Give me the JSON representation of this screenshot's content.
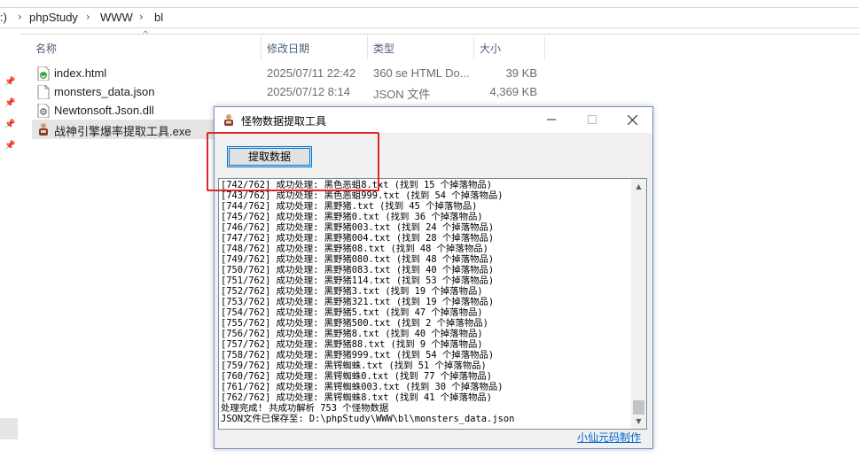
{
  "breadcrumb": {
    "prefix": ":)",
    "items": [
      "phpStudy",
      "WWW",
      "bl"
    ]
  },
  "columns": {
    "name": "名称",
    "date": "修改日期",
    "type": "类型",
    "size": "大小"
  },
  "files": [
    {
      "name": "index.html",
      "date": "2025/07/11 22:42",
      "type": "360 se HTML Do...",
      "size": "39 KB",
      "icon": "html-file-icon"
    },
    {
      "name": "monsters_data.json",
      "date": "2025/07/12 8:14",
      "type": "JSON 文件",
      "size": "4,369 KB",
      "icon": "json-file-icon"
    },
    {
      "name": "Newtonsoft.Json.dll",
      "date": "",
      "type": "",
      "size": "",
      "icon": "dll-file-icon"
    },
    {
      "name": "战神引擎爆率提取工具.exe",
      "date": "",
      "type": "",
      "size": "",
      "icon": "exe-file-icon"
    }
  ],
  "app": {
    "title": "怪物数据提取工具",
    "extract_button": "提取数据",
    "credit": "小仙元码制作",
    "log_lines": [
      "[742/762] 成功处理: 黑色恶蛆8.txt (找到 15 个掉落物品)",
      "[743/762] 成功处理: 黑色恶蛆999.txt (找到 54 个掉落物品)",
      "[744/762] 成功处理: 黑野猪.txt (找到 45 个掉落物品)",
      "[745/762] 成功处理: 黑野猪0.txt (找到 36 个掉落物品)",
      "[746/762] 成功处理: 黑野猪003.txt (找到 24 个掉落物品)",
      "[747/762] 成功处理: 黑野猪004.txt (找到 28 个掉落物品)",
      "[748/762] 成功处理: 黑野猪08.txt (找到 48 个掉落物品)",
      "[749/762] 成功处理: 黑野猪080.txt (找到 48 个掉落物品)",
      "[750/762] 成功处理: 黑野猪083.txt (找到 40 个掉落物品)",
      "[751/762] 成功处理: 黑野猪114.txt (找到 53 个掉落物品)",
      "[752/762] 成功处理: 黑野猪3.txt (找到 19 个掉落物品)",
      "[753/762] 成功处理: 黑野猪321.txt (找到 19 个掉落物品)",
      "[754/762] 成功处理: 黑野猪5.txt (找到 47 个掉落物品)",
      "[755/762] 成功处理: 黑野猪500.txt (找到 2 个掉落物品)",
      "[756/762] 成功处理: 黑野猪8.txt (找到 40 个掉落物品)",
      "[757/762] 成功处理: 黑野猪88.txt (找到 9 个掉落物品)",
      "[758/762] 成功处理: 黑野猪999.txt (找到 54 个掉落物品)",
      "[759/762] 成功处理: 黑锷蜘蛛.txt (找到 51 个掉落物品)",
      "[760/762] 成功处理: 黑锷蜘蛛0.txt (找到 77 个掉落物品)",
      "[761/762] 成功处理: 黑锷蜘蛛003.txt (找到 30 个掉落物品)",
      "[762/762] 成功处理: 黑锷蜘蛛8.txt (找到 41 个掉落物品)",
      "处理完成! 共成功解析 753 个怪物数据",
      "JSON文件已保存至: D:\\phpStudy\\WWW\\bl\\monsters_data.json"
    ]
  },
  "colors": {
    "annotation": "#e0242a",
    "accent": "#0078d7",
    "link": "#0066cc"
  }
}
